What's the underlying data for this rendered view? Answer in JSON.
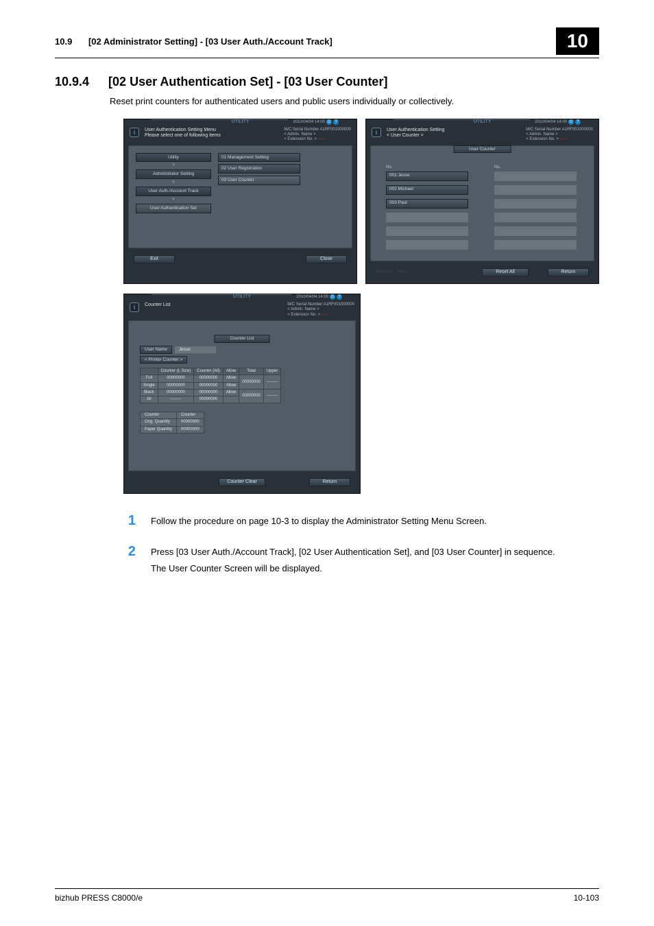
{
  "header": {
    "section_num": "10.9",
    "section_title": "[02 Administrator Setting] - [03 User Auth./Account Track]",
    "chapter": "10"
  },
  "section": {
    "number": "10.9.4",
    "title": "[02 User Authentication Set] - [03 User Counter]",
    "description": "Reset print counters for authenticated users and public users individually or collectively."
  },
  "meta": {
    "utility_label": "UTILITY",
    "datetime": "2010/04/04 14:00",
    "serial_label": "M/C Serial Number",
    "serial_value": "A1RF001000000",
    "admin_label": "< Admin. Name >",
    "ext_label": "< Extension No. >",
    "ext_value": "-----"
  },
  "screen1": {
    "title_line1": "User Authentication Setting Menu",
    "title_line2": "Please select one of following items",
    "crumbs": [
      "Utility",
      "Administrator Setting",
      "User Auth./Account Track",
      "User Authentication Set"
    ],
    "menu": [
      "01 Management Setting",
      "02 User Registration",
      "03 User Counter"
    ],
    "exit": "Exit",
    "close": "Close"
  },
  "screen2": {
    "title": "User Authentication Setting\n< User Counter >",
    "panel_title": "User Counter",
    "col_no": "No.",
    "rows": [
      "001 Jesse",
      "002 Michael",
      "003 Paul"
    ],
    "nav_prev": "Previous",
    "nav_next": "Next",
    "reset_all": "Reset All",
    "ret": "Return"
  },
  "screen3": {
    "title": "Counter List",
    "panel_title": "Counter List",
    "user_name_label": "User Name",
    "user_name_value": "Jesse",
    "printer_counter_label": "< Printer Counter >",
    "tbl_cols": [
      "",
      "Counter (L Size)",
      "Counter (All)",
      "Allow",
      "Total",
      "Upper"
    ],
    "tbl_rows": [
      [
        "Full",
        "00000000",
        "00000000",
        "Allow",
        "00000000",
        "--------"
      ],
      [
        "Single",
        "00000000",
        "00000000",
        "Allow",
        "",
        ""
      ],
      [
        "Black",
        "00000000",
        "00000000",
        "Allow",
        "00000000",
        "--------"
      ],
      [
        "All",
        "--------",
        "00000000",
        "",
        "",
        ""
      ]
    ],
    "tbl2_h": [
      "Counter",
      "Counter"
    ],
    "tbl2_r1": [
      "Orig. Quantity",
      "00000000"
    ],
    "tbl2_r2": [
      "Paper Quantity",
      "00000000"
    ],
    "clear": "Counter Clear",
    "ret": "Return"
  },
  "steps": [
    {
      "n": "1",
      "t": "Follow the procedure on page 10-3 to display the Administrator Setting Menu Screen."
    },
    {
      "n": "2",
      "t": "Press [03 User Auth./Account Track], [02 User Authentication Set], and [03 User Counter] in sequence.",
      "t2": "The User Counter Screen will be displayed."
    }
  ],
  "footer": {
    "left": "bizhub PRESS C8000/e",
    "right": "10-103"
  }
}
